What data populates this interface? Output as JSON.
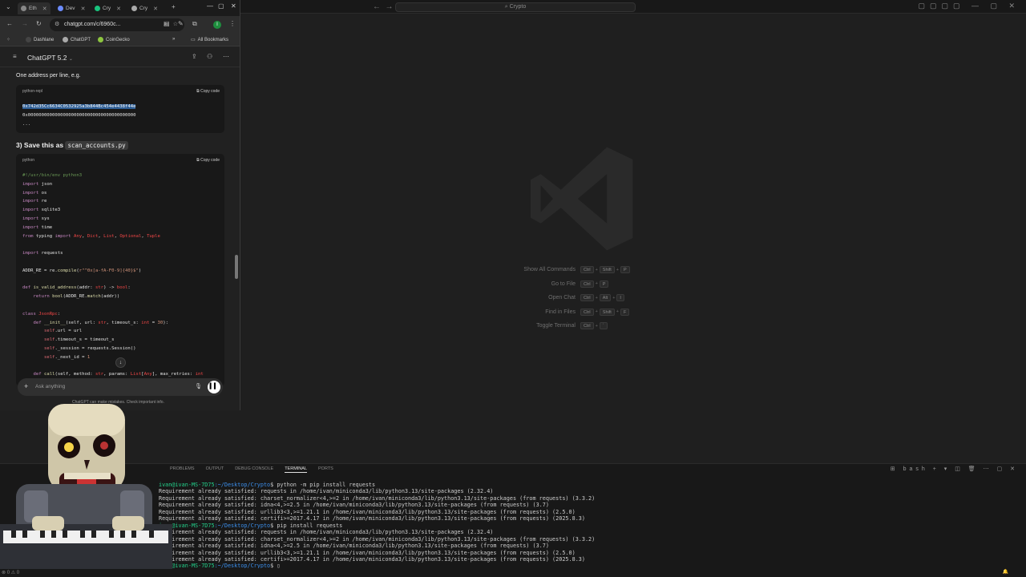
{
  "browser": {
    "tabs": [
      {
        "label": "Eth",
        "color": "#888888"
      },
      {
        "label": "Dev",
        "color": "#6c8cff"
      },
      {
        "label": "Cry",
        "color": "#19c37d"
      },
      {
        "label": "Cry",
        "color": "#aaaaaa"
      }
    ],
    "url": "chatgpt.com/c/6960c...",
    "bookmarks": [
      "Dashlane",
      "ChatGPT",
      "CoinGecko"
    ],
    "all_bookmarks": "All Bookmarks"
  },
  "chat": {
    "model_title": "ChatGPT 5.2",
    "intro_text": "One address per line, e.g.",
    "block1": {
      "lang": "python-repl",
      "copy": "Copy code",
      "lines": [
        "0x742d35Cc6634C0532925a3b844Bc454e4438f44e",
        "0x0000000000000000000000000000000000000000",
        "..."
      ]
    },
    "heading_prefix": "3) Save this as",
    "heading_code": "scan_accounts.py",
    "block2": {
      "lang": "python",
      "copy": "Copy code"
    },
    "composer_placeholder": "Ask anything",
    "disclaimer": "ChatGPT can make mistakes. Check important info."
  },
  "vscode": {
    "search": "Crypto",
    "shortcuts": [
      {
        "name": "Show All Commands",
        "keys": [
          "Ctrl",
          "Shift",
          "P"
        ]
      },
      {
        "name": "Go to File",
        "keys": [
          "Ctrl",
          "P"
        ]
      },
      {
        "name": "Open Chat",
        "keys": [
          "Ctrl",
          "Alt",
          "I"
        ]
      },
      {
        "name": "Find in Files",
        "keys": [
          "Ctrl",
          "Shift",
          "F"
        ]
      },
      {
        "name": "Toggle Terminal",
        "keys": [
          "Ctrl",
          "`"
        ]
      }
    ],
    "panel_tabs": [
      "PROBLEMS",
      "OUTPUT",
      "DEBUG CONSOLE",
      "TERMINAL",
      "PORTS"
    ],
    "active_panel_tab": "TERMINAL",
    "terminal_shell": "bash",
    "terminal": {
      "prompt": "ivan@ivan-MS-7D75",
      "path": ":~/Desktop/Crypto",
      "cmd1": "$ python -m pip install requests",
      "cmd2": "$ pip install requests",
      "out": [
        "Requirement already satisfied: requests in /home/ivan/miniconda3/lib/python3.13/site-packages (2.32.4)",
        "Requirement already satisfied: charset_normalizer<4,>=2 in /home/ivan/miniconda3/lib/python3.13/site-packages (from requests) (3.3.2)",
        "Requirement already satisfied: idna<4,>=2.5 in /home/ivan/miniconda3/lib/python3.13/site-packages (from requests) (3.7)",
        "Requirement already satisfied: urllib3<3,>=1.21.1 in /home/ivan/miniconda3/lib/python3.13/site-packages (from requests) (2.5.0)",
        "Requirement already satisfied: certifi>=2017.4.17 in /home/ivan/miniconda3/lib/python3.13/site-packages (from requests) (2025.8.3)"
      ],
      "end": "$ "
    },
    "status_left": "⊗ 0 ⚠ 0"
  }
}
